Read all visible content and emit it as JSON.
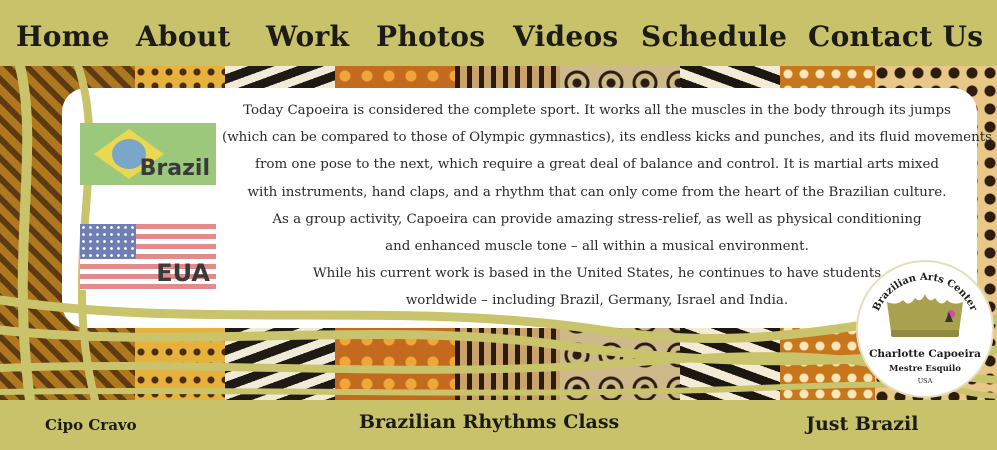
{
  "nav": {
    "home": "Home",
    "about": "About",
    "work": "Work",
    "photos": "Photos",
    "videos": "Videos",
    "schedule": "Schedule",
    "contact": "Contact Us"
  },
  "flags": {
    "brazil_label": "Brazil",
    "usa_label": "EUA"
  },
  "content": {
    "lines": [
      "Today Capoeira is considered the complete sport. It works all the muscles in the body through its jumps",
      "(which can be compared to those of Olympic gymnastics), its endless kicks and punches, and its fluid movements",
      "from one pose to the next, which require a great deal of balance and control. It is martial arts mixed",
      "with instruments, hand claps, and a rhythm that can only come from the heart of the Brazilian culture.",
      "As a group activity, Capoeira can provide amazing stress-relief, as well as physical conditioning",
      "and enhanced muscle tone – all within a musical environment.",
      "While his current work is based in the United States, he continues to have students",
      "worldwide – including Brazil, Germany, Israel and India."
    ]
  },
  "seal": {
    "arc_text": "Brazilian Arts Center",
    "name": "Charlotte Capoeira",
    "subtitle": "Mestre Esquilo",
    "country": "USA"
  },
  "footer": {
    "left": "Cipo Cravo",
    "center": "Brazilian Rhythms Class",
    "right": "Just Brazil"
  },
  "colors": {
    "olive": "#c8c36a",
    "ribbon": "#c9c36b",
    "text_dark": "#1e1b16"
  }
}
